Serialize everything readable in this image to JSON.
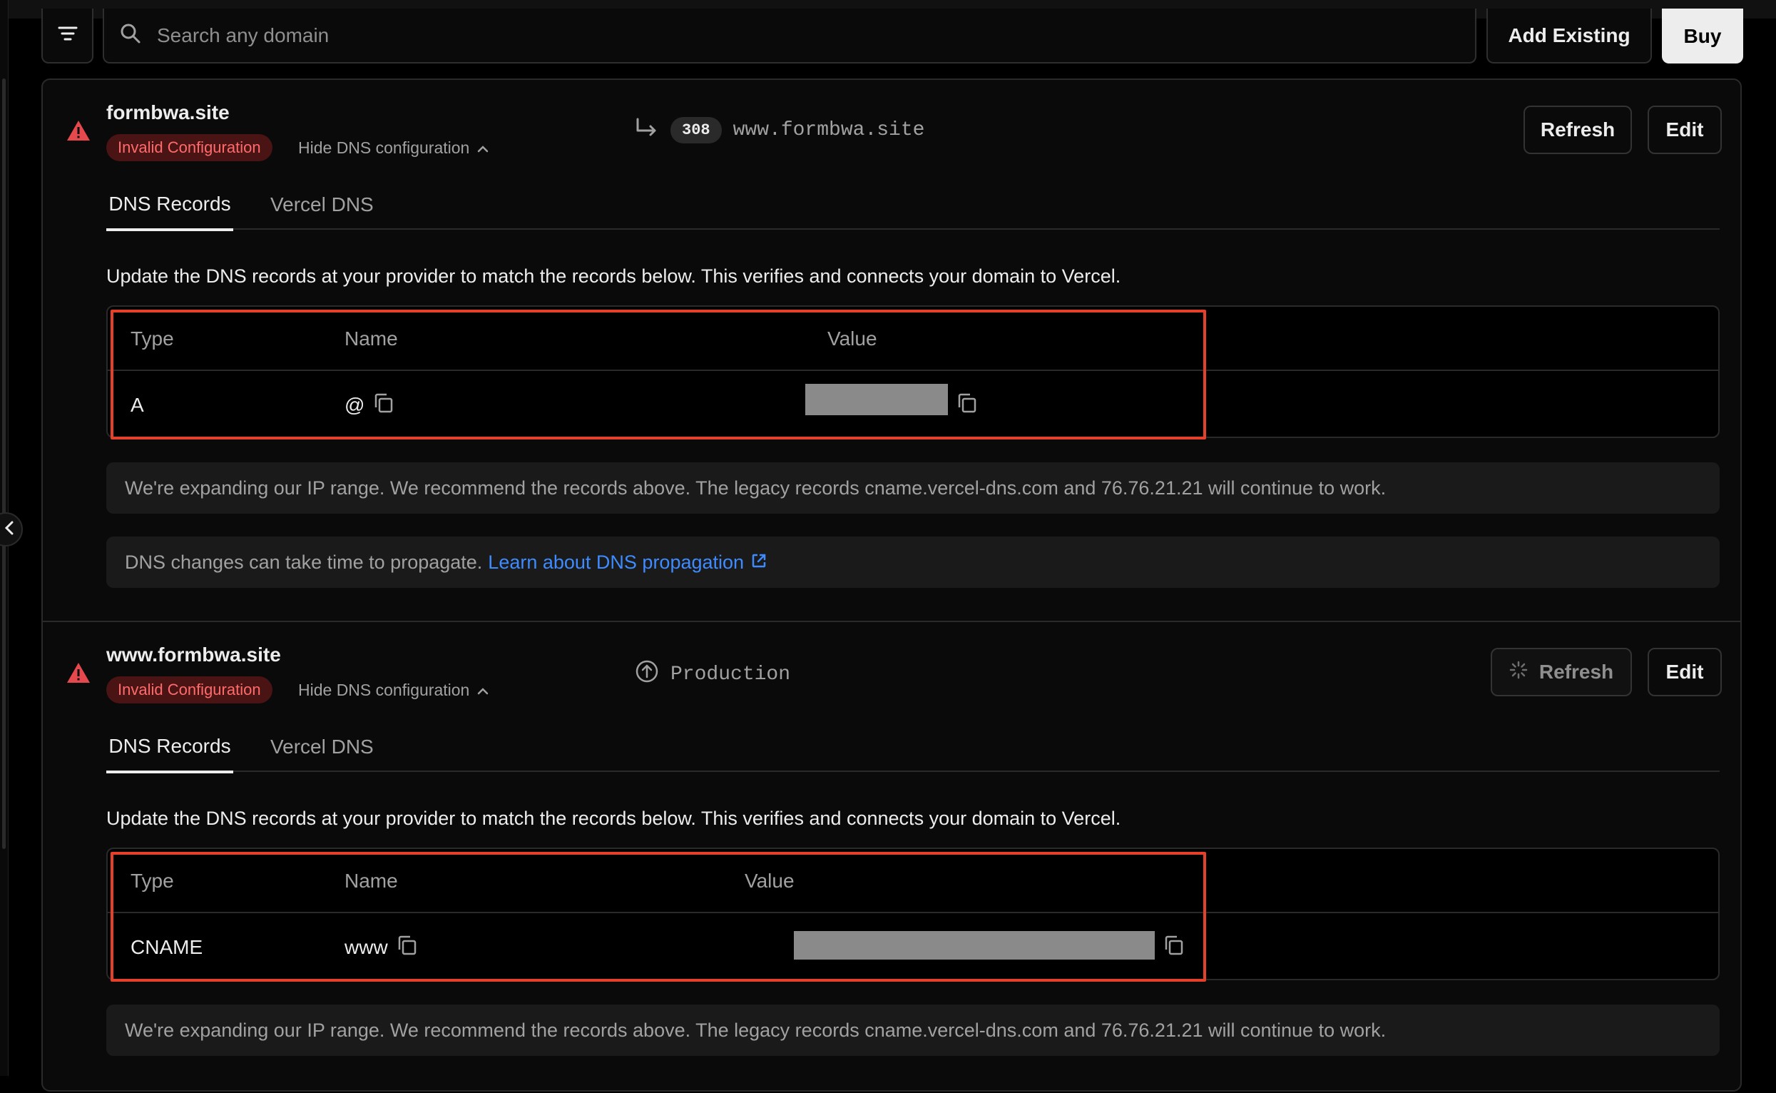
{
  "toolbar": {
    "search_placeholder": "Search any domain",
    "add_existing_label": "Add Existing",
    "buy_label": "Buy"
  },
  "colors": {
    "accent_link": "#3e8bff",
    "warning_red": "#e5484d",
    "highlight_box": "#e5402a"
  },
  "domains": [
    {
      "name": "formbwa.site",
      "status_badge": "Invalid Configuration",
      "toggle_label": "Hide DNS configuration",
      "redirect_code": "308",
      "redirect_target": "www.formbwa.site",
      "refresh_label": "Refresh",
      "edit_label": "Edit",
      "tabs": [
        "DNS Records",
        "Vercel DNS"
      ],
      "instructions": "Update the DNS records at your provider to match the records below. This verifies and connects your domain to Vercel.",
      "table": {
        "headers": [
          "Type",
          "Name",
          "Value"
        ],
        "row": {
          "type": "A",
          "name": "@",
          "value": ""
        }
      },
      "ip_note": "We're expanding our IP range. We recommend the records above. The legacy records cname.vercel-dns.com and 76.76.21.21 will continue to work.",
      "propagation_note": "DNS changes can take time to propagate.",
      "propagation_link": "Learn about DNS propagation"
    },
    {
      "name": "www.formbwa.site",
      "status_badge": "Invalid Configuration",
      "toggle_label": "Hide DNS configuration",
      "environment": "Production",
      "refresh_label": "Refresh",
      "edit_label": "Edit",
      "tabs": [
        "DNS Records",
        "Vercel DNS"
      ],
      "instructions": "Update the DNS records at your provider to match the records below. This verifies and connects your domain to Vercel.",
      "table": {
        "headers": [
          "Type",
          "Name",
          "Value"
        ],
        "row": {
          "type": "CNAME",
          "name": "www",
          "value": ""
        }
      },
      "ip_note": "We're expanding our IP range. We recommend the records above. The legacy records cname.vercel-dns.com and 76.76.21.21 will continue to work."
    }
  ]
}
